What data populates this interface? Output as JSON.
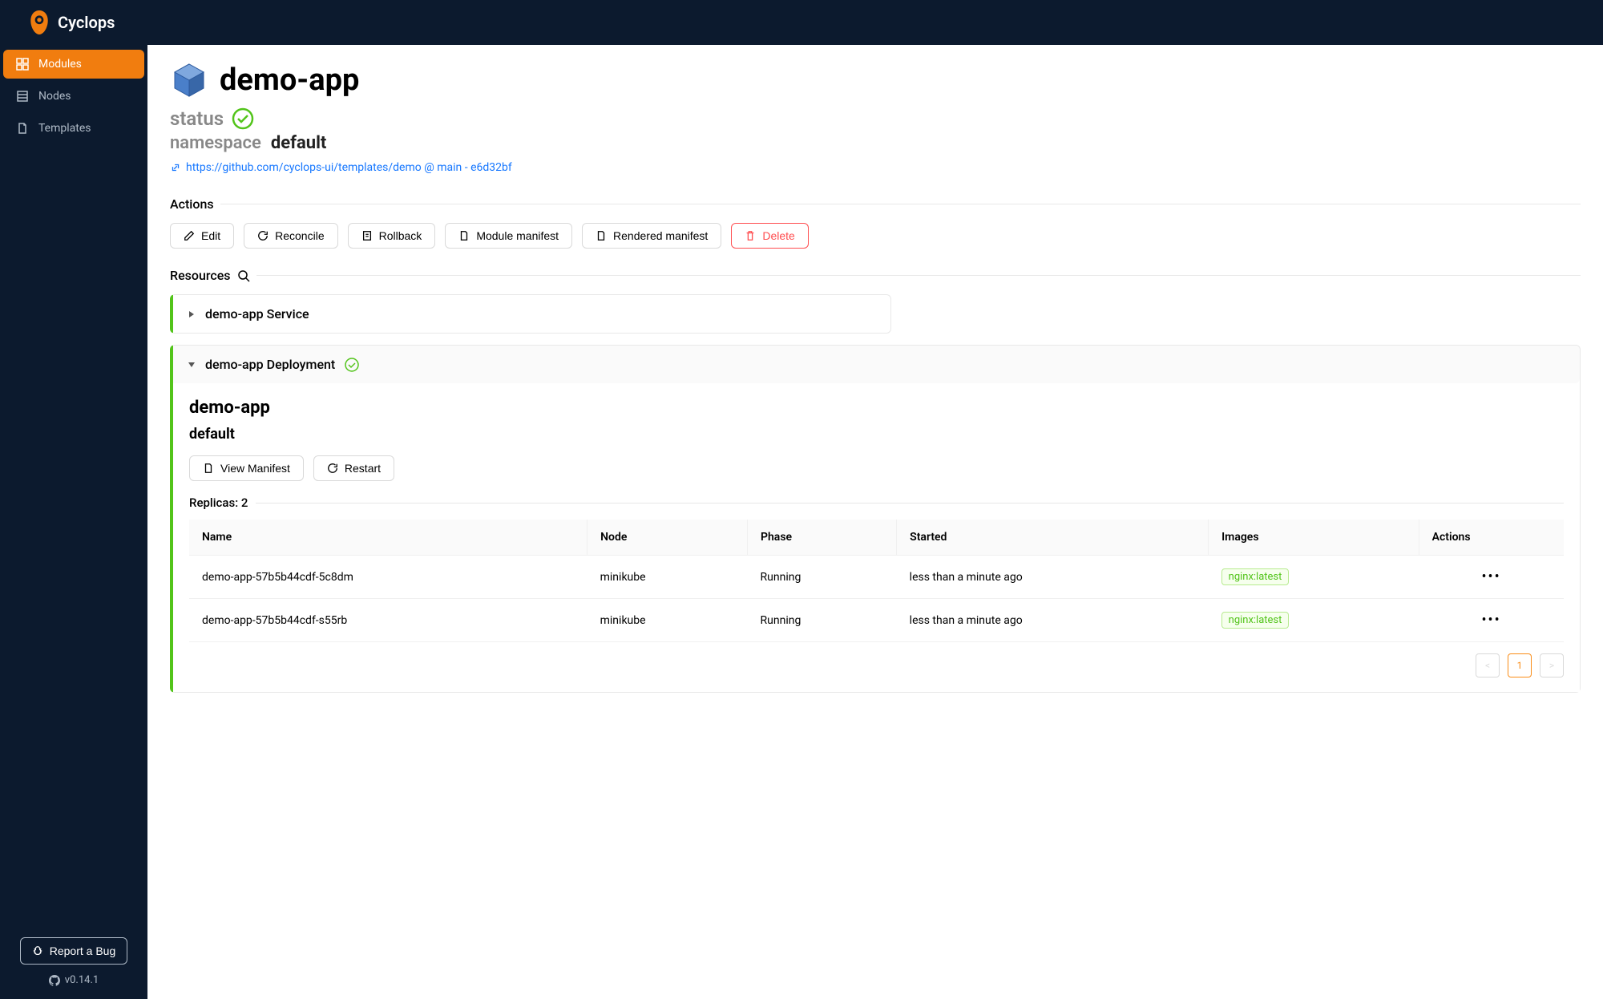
{
  "brand": "Cyclops",
  "sidebar": {
    "items": [
      {
        "label": "Modules"
      },
      {
        "label": "Nodes"
      },
      {
        "label": "Templates"
      }
    ],
    "bug_label": "Report a Bug",
    "version": "v0.14.1"
  },
  "module": {
    "name": "demo-app",
    "status_label": "status",
    "namespace_label": "namespace",
    "namespace": "default",
    "template_link": "https://github.com/cyclops-ui/templates/demo @ main - e6d32bf"
  },
  "sections": {
    "actions": "Actions",
    "resources": "Resources"
  },
  "actions": {
    "edit": "Edit",
    "reconcile": "Reconcile",
    "rollback": "Rollback",
    "module_manifest": "Module manifest",
    "rendered_manifest": "Rendered manifest",
    "delete": "Delete"
  },
  "resources": [
    {
      "title": "demo-app Service",
      "expanded": false
    },
    {
      "title": "demo-app Deployment",
      "expanded": true
    }
  ],
  "deployment": {
    "name": "demo-app",
    "namespace": "default",
    "view_manifest": "View Manifest",
    "restart": "Restart",
    "replicas_label": "Replicas:",
    "replicas_count": "2",
    "columns": {
      "name": "Name",
      "node": "Node",
      "phase": "Phase",
      "started": "Started",
      "images": "Images",
      "actions": "Actions"
    },
    "pods": [
      {
        "name": "demo-app-57b5b44cdf-5c8dm",
        "node": "minikube",
        "phase": "Running",
        "started": "less than a minute ago",
        "image": "nginx:latest"
      },
      {
        "name": "demo-app-57b5b44cdf-s55rb",
        "node": "minikube",
        "phase": "Running",
        "started": "less than a minute ago",
        "image": "nginx:latest"
      }
    ]
  },
  "pagination": {
    "current": "1"
  }
}
